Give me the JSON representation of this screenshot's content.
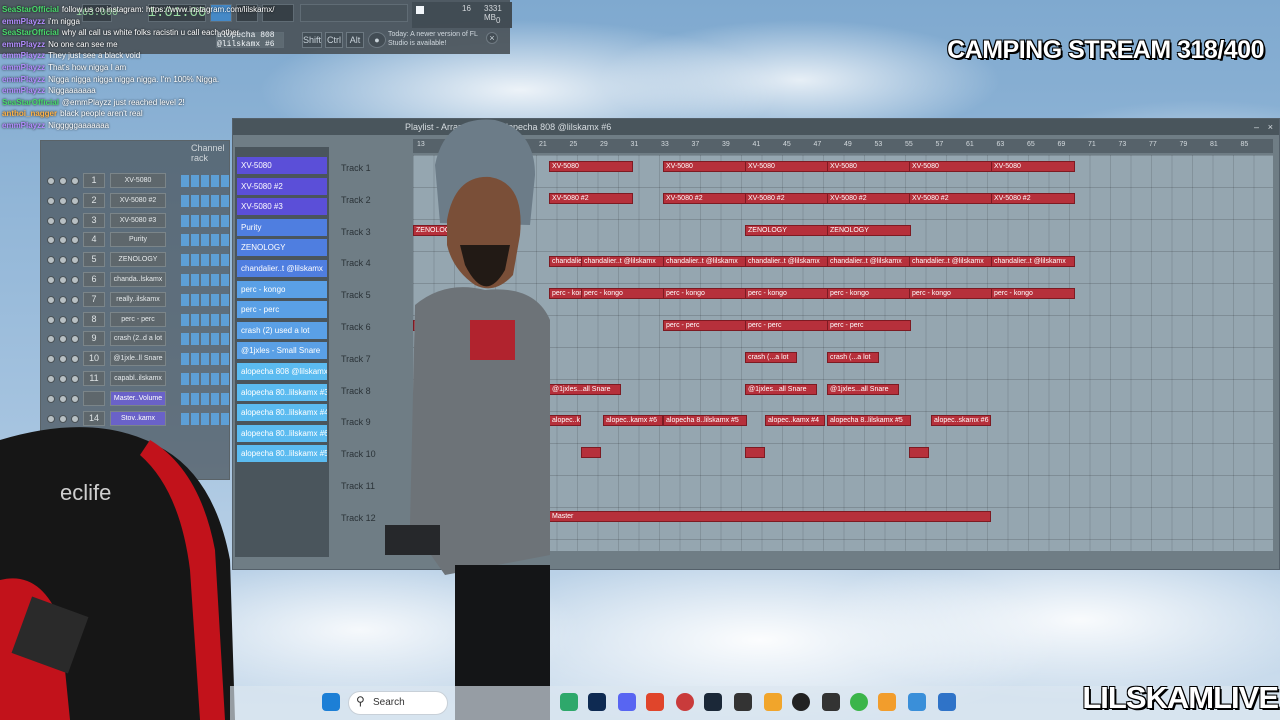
{
  "stream": {
    "title": "CAMPING STREAM 318/400",
    "watermark": "LILSKAMLIVE"
  },
  "fl_toolbar": {
    "time": "1:01:00",
    "tempo": "163.000",
    "cpu_value": "16",
    "memory": "3331 MB",
    "polyphony": "0",
    "hint_text": "Today: A newer version of FL Studio is available!",
    "pattern_name": "alopecha 808 @lilskamx #6",
    "buttons": [
      "Shift",
      "Ctrl",
      "Alt"
    ]
  },
  "chat": [
    {
      "user": "SeaStarOfficial",
      "text": "follow us on instagram: https://www.instagram.com/lilskamx/",
      "color": "#48d96b"
    },
    {
      "user": "emmPlayzz",
      "text": "i'm nigga",
      "color": "#b38cff"
    },
    {
      "user": "SeaStarOfficial",
      "text": "why all call us white folks racistin u call each other",
      "color": "#48d96b"
    },
    {
      "user": "emmPlayzz",
      "text": "No one can see me",
      "color": "#b38cff"
    },
    {
      "user": "emmPlayzz",
      "text": "They just see a black void",
      "color": "#b38cff"
    },
    {
      "user": "emmPlayzz",
      "text": "That's how nigga I am",
      "color": "#b38cff"
    },
    {
      "user": "emmPlayzz",
      "text": "Nigga nigga nigga nigga nigga. I'm 100% Nigga.",
      "color": "#b38cff"
    },
    {
      "user": "emmPlayzz",
      "text": "Niggaaaaaaa",
      "color": "#b38cff"
    },
    {
      "user": "SeaStarOfficial",
      "text": "@emmPlayzz just reached level 2!",
      "color": "#48d96b"
    },
    {
      "user": "anthoi_nagger",
      "text": "black people aren't real",
      "color": "#ffb347"
    },
    {
      "user": "emmPlayzz",
      "text": "Nigggggaaaaaaa",
      "color": "#b38cff"
    }
  ],
  "channel_rack": {
    "title": "Channel rack",
    "channels": [
      {
        "num": "1",
        "name": "XV-5080"
      },
      {
        "num": "2",
        "name": "XV-5080 #2"
      },
      {
        "num": "3",
        "name": "XV-5080 #3"
      },
      {
        "num": "4",
        "name": "Purity"
      },
      {
        "num": "5",
        "name": "ZENOLOGY"
      },
      {
        "num": "6",
        "name": "chanda..lskamx"
      },
      {
        "num": "7",
        "name": "really..ilskamx"
      },
      {
        "num": "8",
        "name": "perc - perc"
      },
      {
        "num": "9",
        "name": "crash (2..d a lot"
      },
      {
        "num": "10",
        "name": "@1jxle..ll Snare"
      },
      {
        "num": "11",
        "name": "capabl..ilskamx"
      },
      {
        "num": "",
        "name": "Master..Volume"
      },
      {
        "num": "14",
        "name": "Stov..kamx"
      }
    ]
  },
  "playlist": {
    "title": "Playlist - Arrangement › alopecha 808 @lilskamx #6",
    "patterns": [
      "XV-5080",
      "XV-5080 #2",
      "XV-5080 #3",
      "Purity",
      "ZENOLOGY",
      "chandalier..t @lilskamx",
      "perc - kongo",
      "perc - perc",
      "crash (2) used a lot",
      "@1jxles - Small Snare",
      "alopecha 808 @lilskamx",
      "alopecha 80..lilskamx #3",
      "alopecha 80..lilskamx #4",
      "alopecha 80..lilskamx #6",
      "alopecha 80..lilskamx #5"
    ],
    "tracks": [
      "Track 1",
      "Track 2",
      "Track 3",
      "Track 4",
      "Track 5",
      "Track 6",
      "Track 7",
      "Track 8",
      "Track 9",
      "Track 10",
      "Track 11",
      "Track 12"
    ],
    "bars": [
      "13",
      "15",
      "17",
      "19",
      "21",
      "25",
      "29",
      "31",
      "33",
      "37",
      "39",
      "41",
      "45",
      "47",
      "49",
      "53",
      "55",
      "57",
      "61",
      "63",
      "65",
      "69",
      "71",
      "73",
      "77",
      "79",
      "81",
      "85"
    ],
    "clip_labels": {
      "t1": "XV-5080",
      "t2": "XV-5080 #2",
      "t3": "ZENOLOGY",
      "t4": "chandalier..t @lilskamx",
      "t5": "perc - kongo",
      "t6": "perc - perc",
      "t7": "crash (...a lot",
      "t8": "@1jxles...all Snare",
      "t9a": "alopec..kamx #5",
      "t9b": "alopec..kamx #6",
      "t9c": "alopecha 8..lilskamx #5",
      "t9d": "alopec..kamx #4",
      "t9e": "alopec..skamx #6",
      "t12": "Master"
    }
  },
  "taskbar": {
    "search": "Search"
  },
  "chair_brand": "eclife"
}
